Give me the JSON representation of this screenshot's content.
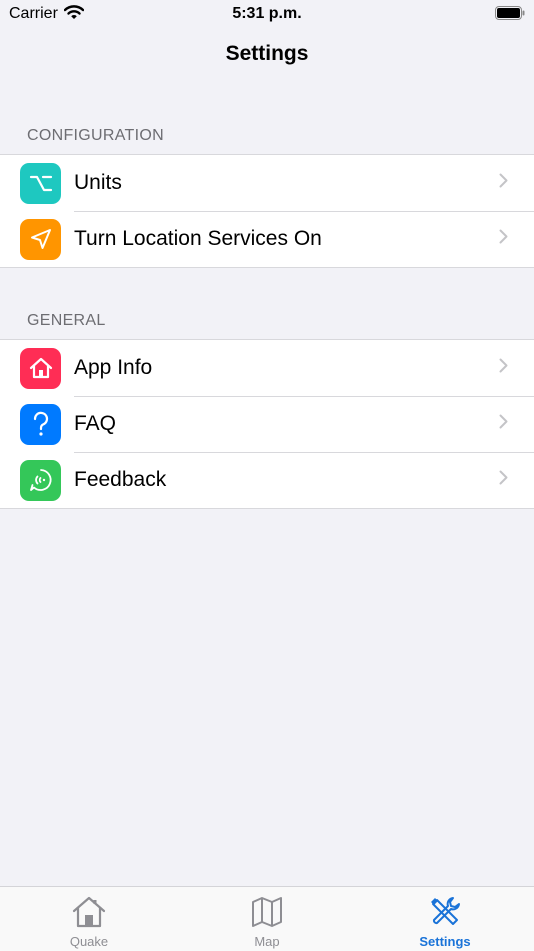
{
  "status_bar": {
    "carrier": "Carrier",
    "time": "5:31 p.m."
  },
  "nav": {
    "title": "Settings"
  },
  "sections": [
    {
      "header": "CONFIGURATION",
      "items": [
        {
          "label": "Units",
          "icon": "option-key-icon",
          "color": "#1ec8c0"
        },
        {
          "label": "Turn Location Services On",
          "icon": "location-arrow-icon",
          "color": "#ff9500"
        }
      ]
    },
    {
      "header": "GENERAL",
      "items": [
        {
          "label": "App Info",
          "icon": "house-icon",
          "color": "#ff2d55"
        },
        {
          "label": "FAQ",
          "icon": "question-mark-icon",
          "color": "#007aff"
        },
        {
          "label": "Feedback",
          "icon": "feedback-icon",
          "color": "#34c759"
        }
      ]
    }
  ],
  "tab_bar": {
    "tabs": [
      {
        "label": "Quake",
        "icon": "house-outline-icon"
      },
      {
        "label": "Map",
        "icon": "map-icon"
      },
      {
        "label": "Settings",
        "icon": "tools-icon",
        "active": true
      }
    ],
    "active_color": "#1a73d8",
    "inactive_color": "#8e8e93"
  }
}
